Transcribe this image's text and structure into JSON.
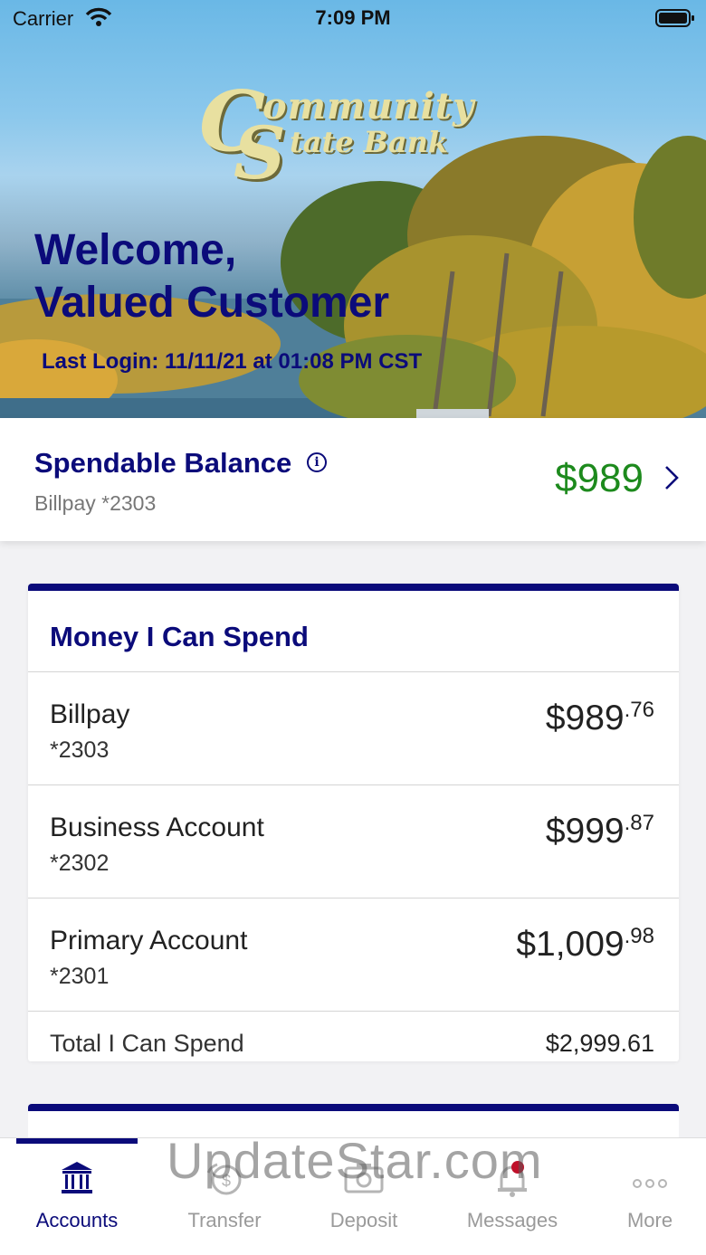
{
  "status_bar": {
    "carrier": "Carrier",
    "time": "7:09 PM"
  },
  "header": {
    "logo_line1": "ommunity",
    "logo_line2": "tate Bank",
    "logo_c": "C",
    "logo_s": "S",
    "welcome_line1": "Welcome,",
    "welcome_line2": "Valued Customer",
    "last_login": "Last Login: 11/11/21 at 01:08 PM CST"
  },
  "spendable": {
    "title": "Spendable Balance",
    "account": "Billpay *2303",
    "amount": "$989",
    "info_icon": "info-icon",
    "chevron_icon": "chevron-right-icon"
  },
  "money_card": {
    "title": "Money I Can Spend",
    "accounts": [
      {
        "name": "Billpay",
        "number": "*2303",
        "dollars": "$989",
        "cents": ".76"
      },
      {
        "name": "Business Account",
        "number": "*2302",
        "dollars": "$999",
        "cents": ".87"
      },
      {
        "name": "Primary Account",
        "number": "*2301",
        "dollars": "$1,009",
        "cents": ".98"
      }
    ],
    "total_label": "Total I Can Spend",
    "total_amount": "$2,999.61"
  },
  "tabbar": {
    "tabs": [
      {
        "label": "Accounts",
        "icon": "bank-icon",
        "active": true
      },
      {
        "label": "Transfer",
        "icon": "transfer-icon",
        "active": false
      },
      {
        "label": "Deposit",
        "icon": "camera-icon",
        "active": false
      },
      {
        "label": "Messages",
        "icon": "bell-icon",
        "active": false,
        "badge": true
      },
      {
        "label": "More",
        "icon": "more-icon",
        "active": false
      }
    ]
  },
  "watermark": "UpdateStar.com",
  "colors": {
    "brand_navy": "#0b0b7a",
    "balance_green": "#1d8a1d",
    "badge_red": "#c0102a"
  }
}
